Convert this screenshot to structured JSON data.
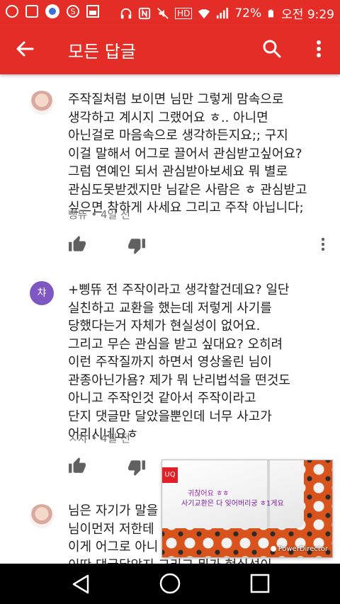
{
  "status_bar": {
    "battery": "72%",
    "time": "오전 9:29",
    "icons": [
      "app-notification-icon",
      "circle-icon",
      "sound-app-icon",
      "sdb-app-icon",
      "image-icon",
      "headphones-icon",
      "nfc-icon",
      "mute-icon",
      "hd-icon",
      "wifi-icon",
      "signal-icon",
      "battery-icon"
    ],
    "hd_label": "HD"
  },
  "app_bar": {
    "title": "모든 답글",
    "background_color": "#e52d27",
    "icons": [
      "back-arrow-icon",
      "search-icon",
      "more-vert-icon"
    ]
  },
  "comments": [
    {
      "text": "주작질처럼 보이면 님만 그렇게 맘속으로\n생각하고 계시지 그랬어요 ㅎ.. 아니면\n아닌걸로 마음속으로 생각하든지요;; 구지\n이걸 말해서 어그로 끌어서 관심받고싶어요?\n그럼 연예인 되서 관심받아보세요 뭐 별로\n관심도못받겠지만 님같은 사람은 ㅎ 관심받고\n싶으면 착하게 사세요 그리고 주작 아닙니다;",
      "author": "삥뜌",
      "time": "4일 전",
      "avatar": "photo"
    },
    {
      "text": "+삥뜌 전 주작이라고 생각할건데요? 일단\n실친하고 교환을 했는데 저렇게 사기를\n당했다는거 자체가 현실성이 없어요.\n그리고 무슨 관심을 받고 싶대요? 오히려\n이런 주작질까지 하면서 영상올린 님이\n관종아닌가욤? 제가 뭐 난리법석을 떤것도\n아니고 주작인것 같아서 주작이라고\n단지 댓글만 달았을뿐인데 너무 사고가\n어리시네요ㅎ",
      "author": "ㅅ챠",
      "time": "4일 전",
      "avatar": "letter",
      "avatar_letter": "챠",
      "avatar_color": "#7e57c2"
    },
    {
      "text": "님은 자기가 말을\n님이먼저 저한테\n이게 어그로 아니\n이딴 댓글달았지 그리고 뭐가 현실성이",
      "avatar": "photo"
    }
  ],
  "meta_separator": " • ",
  "pip_video": {
    "logo_text": "UQ",
    "caption_line1": "귀찮어요 ㅎㅎ",
    "caption_line2": "사기교환은 다 잊어버리궁 ㅎ1게요",
    "watermark": "PowerDirector"
  },
  "nav_bar": {
    "icons": [
      "nav-back-icon",
      "nav-home-icon",
      "nav-recents-icon"
    ]
  }
}
